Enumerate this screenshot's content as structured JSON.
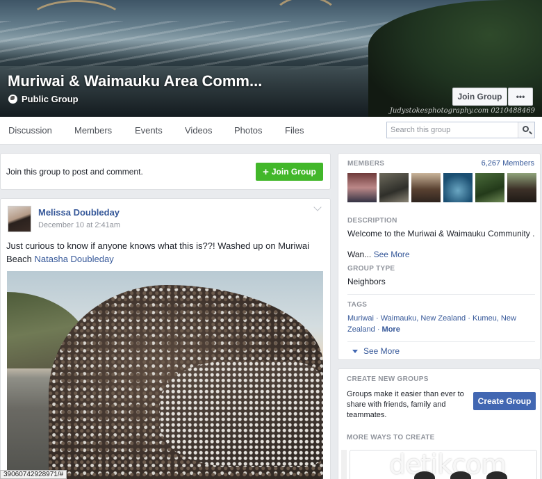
{
  "cover": {
    "title": "Muriwai & Waimauku Area Comm...",
    "privacy": "Public Group",
    "watermark": "Judystokesphotography.com 0210488469",
    "join_button": "Join Group",
    "more_button": "•••"
  },
  "tabs": [
    "Discussion",
    "Members",
    "Events",
    "Videos",
    "Photos",
    "Files"
  ],
  "search": {
    "placeholder": "Search this group"
  },
  "join_bar": {
    "text": "Join this group to post and comment.",
    "button": "Join Group"
  },
  "post": {
    "author": "Melissa Doubleday",
    "time": "December 10 at 2:41am",
    "text": "Just curious to know if anyone knows what this is??! Washed up on Muriwai Beach",
    "mention": "Natasha Doubleday"
  },
  "sidebar": {
    "members_heading": "MEMBERS",
    "members_count": "6,267 Members",
    "description_heading": "DESCRIPTION",
    "description": "Welcome to the Muriwai & Waimauku Community ...",
    "description_more": "Wan...",
    "see_more": "See More",
    "group_type_heading": "GROUP TYPE",
    "group_type": "Neighbors",
    "tags_heading": "TAGS",
    "tags": [
      "Muriwai",
      "Waimauku, New Zealand",
      "Kumeu, New Zealand"
    ],
    "tags_more": "More",
    "see_more_bottom": "See More"
  },
  "create": {
    "heading": "CREATE NEW GROUPS",
    "text": "Groups make it easier than ever to share with friends, family and teammates.",
    "button": "Create Group",
    "more_ways": "MORE WAYS TO CREATE"
  },
  "status_url": "39060742928971/#",
  "watermark_site": "detikcom"
}
